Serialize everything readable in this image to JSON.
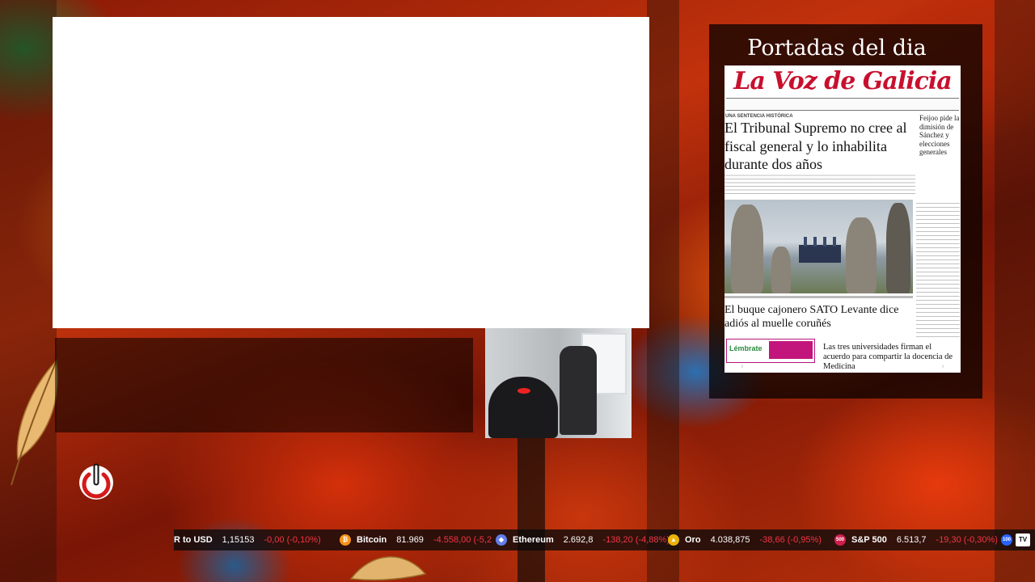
{
  "colors": {
    "accent_red": "#c8102e",
    "negative": "#f23645",
    "ticker_bg": "#0a0a0c"
  },
  "newspaper_widget": {
    "title": "Portadas del dia",
    "paper_name": "La Voz de Galicia",
    "kicker": "UNA SENTENCIA HISTÓRICA",
    "main_headline": "El Tribunal Supremo no cree al fiscal general y lo inhabilita durante dos años",
    "side_headline": "Feijoo pide la dimisión de Sánchez y elecciones generales",
    "second_headline": "El buque cajonero SATO Levante dice adiós al muelle coruñés",
    "bottom_headline": "Las tres universidades firman el acuerdo para compartir la docencia de Medicina",
    "ad_brand": "Lémbrate",
    "nav_prev_icon": "chevron-left-icon",
    "nav_next_icon": "chevron-right-icon",
    "nav_pause": "II"
  },
  "power_button": {
    "icon": "power-icon",
    "color": "#d41a1a"
  },
  "ticker": {
    "items": [
      {
        "name": "R to USD",
        "price": "1,15153",
        "change": "-0,00 (-0,10%)",
        "icon": "",
        "icon_color": ""
      },
      {
        "name": "Bitcoin",
        "price": "81.969",
        "change": "-4.558,00 (-5,2",
        "icon": "bitcoin-icon",
        "icon_color": "#f7931a"
      },
      {
        "name": "Ethereum",
        "price": "2.692,8",
        "change": "-138,20 (-4,88%)",
        "icon": "ethereum-icon",
        "icon_color": "#627eea"
      },
      {
        "name": "Oro",
        "price": "4.038,875",
        "change": "-38,66 (-0,95%)",
        "icon": "gold-icon",
        "icon_color": "#e9b308"
      },
      {
        "name": "S&P 500",
        "price": "6.513,7",
        "change": "-19,30 (-0,30%)",
        "icon": "sp500-icon",
        "icon_color": "#d21d4f"
      }
    ],
    "sp500_icon_label": "500",
    "trailing_icon_label": "100",
    "logo": "TV"
  }
}
